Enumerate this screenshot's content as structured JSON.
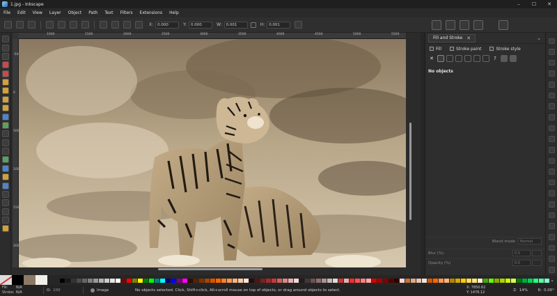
{
  "window": {
    "title": "1.jpg - Inkscape",
    "min_glyph": "–",
    "max_glyph": "☐",
    "close_glyph": "✕"
  },
  "menu": [
    "File",
    "Edit",
    "View",
    "Layer",
    "Object",
    "Path",
    "Text",
    "Filters",
    "Extensions",
    "Help"
  ],
  "controls": {
    "x_label": "X:",
    "x_value": "0.000",
    "y_label": "Y:",
    "y_value": "0.000",
    "w_label": "W:",
    "w_value": "0.001",
    "h_label": "H:",
    "h_value": "0.001"
  },
  "ruler": {
    "top_ticks": [
      "1000",
      "1500",
      "2000",
      "2500",
      "3000",
      "3500",
      "4000",
      "4500",
      "5000",
      "5500"
    ],
    "left_ticks": [
      "-500",
      "0",
      "500",
      "1000",
      "1500",
      "2000"
    ]
  },
  "dock": {
    "tab_label": "Fill and Stroke",
    "close_glyph": "✕",
    "menu_glyph": "⌄",
    "fill_tab": "Fill",
    "stroke_paint_tab": "Stroke paint",
    "stroke_style_tab": "Stroke style",
    "no_objects": "No objects",
    "unknown_glyph": "?",
    "blend_label": "Blend mode",
    "blend_value": "Normal",
    "blur_label": "Blur (%)",
    "blur_value": "0.0",
    "opacity_label": "Opacity (%)",
    "opacity_value": "0.0"
  },
  "palette": {
    "menu_glyph": "⌄",
    "swatches": [
      "#000000",
      "#1a1a1a",
      "#333333",
      "#4d4d4d",
      "#666666",
      "#808080",
      "#999999",
      "#b3b3b3",
      "#cccccc",
      "#e6e6e6",
      "#ffffff",
      "#800000",
      "#ff0000",
      "#808000",
      "#ffff00",
      "#008000",
      "#00ff00",
      "#008080",
      "#00ffff",
      "#000080",
      "#0000ff",
      "#800080",
      "#ff00ff",
      "#2b1100",
      "#552200",
      "#803300",
      "#aa4400",
      "#d45500",
      "#ff6600",
      "#ff7f2a",
      "#ff9955",
      "#ffb380",
      "#ffccaa",
      "#ffe6d5",
      "#280b0b",
      "#501616",
      "#782121",
      "#a02c2c",
      "#c83737",
      "#d35f5f",
      "#de8787",
      "#e9afaf",
      "#f4d7d7",
      "#241c1c",
      "#483737",
      "#6c5353",
      "#916f6f",
      "#ac9393",
      "#c8b7b7",
      "#e3dbdb",
      "#c83737",
      "#e9afaf",
      "#ff2a2a",
      "#ff5555",
      "#ff8080",
      "#ffaaaa",
      "#d40000",
      "#aa0000",
      "#800000",
      "#550000",
      "#2b0000",
      "#ffd5d5",
      "#c87137",
      "#deaa87",
      "#e9c6af",
      "#f4e3d7",
      "#d45500",
      "#ff6600",
      "#ff9955",
      "#ffb380",
      "#aa8800",
      "#d4aa00",
      "#ffcc00",
      "#ffdd55",
      "#ffe680",
      "#fff6d5",
      "#44aa00",
      "#66ff00",
      "#88aa00",
      "#aad400",
      "#ccff00",
      "#ddff55",
      "#008000",
      "#00aa44",
      "#00d455",
      "#2aff80",
      "#55ffaa",
      "#80ffcc"
    ]
  },
  "status": {
    "fill_label": "Fill:",
    "fill_value": "N/A",
    "stroke_label": "Stroke:",
    "stroke_value": "N/A",
    "o_label": "O:",
    "o_value": "100",
    "layer": "Image",
    "message": "No objects selected. Click, Shift+click, Alt+scroll mouse on top of objects, or drag around objects to select.",
    "x_label": "X:",
    "x_value": "7850.62",
    "y_label": "Y:",
    "y_value": "1476.12",
    "z_label": "Z:",
    "zoom": "14%",
    "r_label": "R:",
    "rotation": "0.00°"
  }
}
